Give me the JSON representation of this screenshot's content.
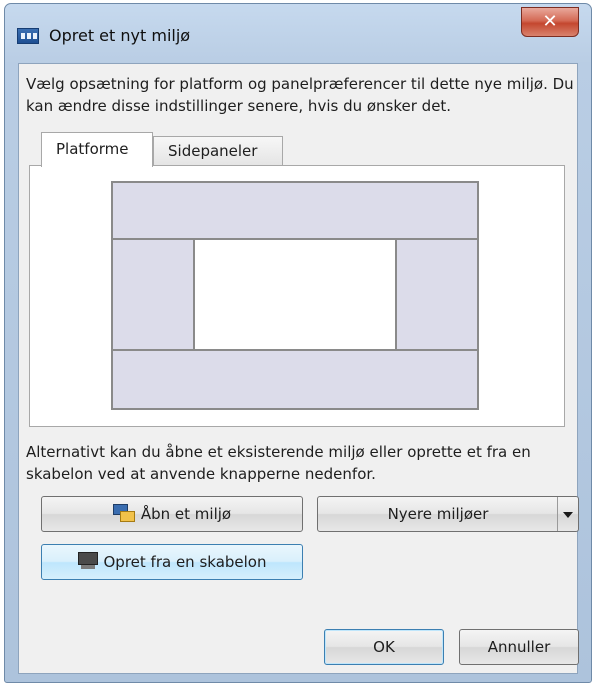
{
  "window": {
    "title": "Opret et nyt miljø",
    "close_glyph": "✕"
  },
  "intro_text": "Vælg opsætning for platform og panelpræferencer til dette nye miljø. Du kan ændre disse indstillinger senere, hvis du ønsker det.",
  "tabs": [
    {
      "label": "Platforme",
      "active": true
    },
    {
      "label": "Sidepaneler",
      "active": false
    }
  ],
  "preview": {
    "panel_color": "#dcdcea",
    "center_color": "#ffffff"
  },
  "alternative_text": "Alternativt kan du åbne et eksisterende miljø eller oprette et fra en skabelon ved at anvende knapperne nedenfor.",
  "buttons": {
    "open_environment": {
      "label": "Åbn et miljø",
      "icon": "open-folder-icon"
    },
    "recent_environments": {
      "label": "Nyere miljøer",
      "icon": "dropdown-arrow-icon"
    },
    "create_from_template": {
      "label": "Opret fra en skabelon",
      "icon": "template-monitor-icon"
    },
    "ok": {
      "label": "OK"
    },
    "cancel": {
      "label": "Annuller"
    }
  }
}
